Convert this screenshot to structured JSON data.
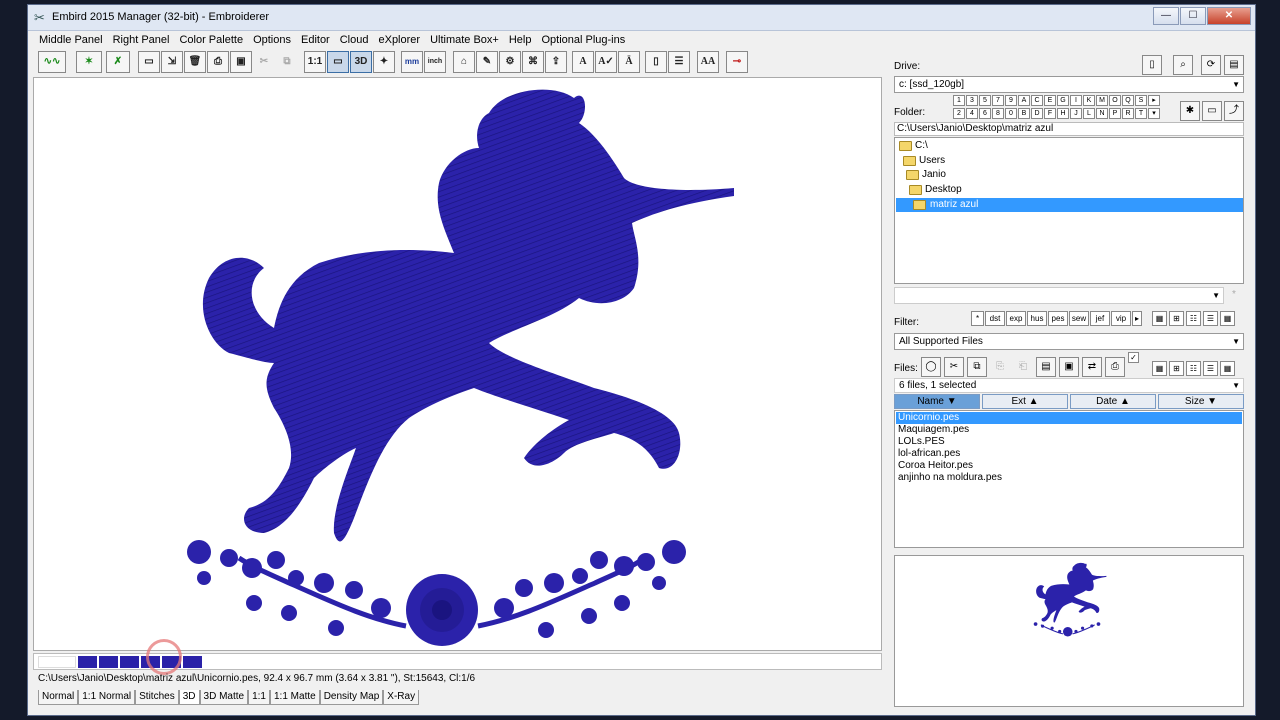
{
  "window": {
    "title": "Embird 2015 Manager (32-bit) - Embroiderer"
  },
  "menu": [
    "Middle Panel",
    "Right Panel",
    "Color Palette",
    "Options",
    "Editor",
    "Cloud",
    "eXplorer",
    "Ultimate Box+",
    "Help",
    "Optional Plug-ins"
  ],
  "toolbar": {
    "zoom_1_1": "1:1",
    "view_3d": "3D",
    "mm_label": "mm",
    "inch_label": "inch",
    "text_a": "A",
    "aa_label": "AA"
  },
  "canvas": {
    "thread_color": "#2a21a8"
  },
  "swatches": {
    "count": 6,
    "color": "#2a21a8"
  },
  "status": {
    "text": "C:\\Users\\Janio\\Desktop\\matriz azul\\Unicornio.pes, 92.4 x 96.7 mm (3.64 x 3.81 \"), St:15643, Cl:1/6"
  },
  "view_tabs": [
    "Normal",
    "1:1 Normal",
    "Stitches",
    "3D",
    "3D Matte",
    "1:1",
    "1:1 Matte",
    "Density Map",
    "X-Ray"
  ],
  "right": {
    "drive_label": "Drive:",
    "drive_value": "c: [ssd_120gb]",
    "folder_label": "Folder:",
    "folder_keys_row1": [
      "1",
      "3",
      "5",
      "7",
      "9",
      "A",
      "C",
      "E",
      "G",
      "I",
      "K",
      "M",
      "O",
      "Q",
      "S"
    ],
    "folder_keys_row2": [
      "2",
      "4",
      "6",
      "8",
      "0",
      "B",
      "D",
      "F",
      "H",
      "J",
      "L",
      "N",
      "P",
      "R",
      "T"
    ],
    "current_path": "C:\\Users\\Janio\\Desktop\\matriz azul",
    "tree": [
      "C:\\",
      "Users",
      "Janio",
      "Desktop",
      "matriz azul"
    ],
    "filter_label": "Filter:",
    "filter_buttons": [
      "*",
      "dst",
      "exp",
      "hus",
      "pes",
      "sew",
      "jef",
      "vip"
    ],
    "filter_value": "All Supported Files",
    "files_label": "Files:",
    "files_count": "6 files, 1 selected",
    "columns": [
      "Name ▼",
      "Ext ▲",
      "Date ▲",
      "Size ▼"
    ],
    "files": [
      "Unicornio.pes",
      "Maquiagem.pes",
      "LOLs.PES",
      "lol-african.pes",
      "Coroa Heitor.pes",
      "anjinho na moldura.pes"
    ]
  }
}
